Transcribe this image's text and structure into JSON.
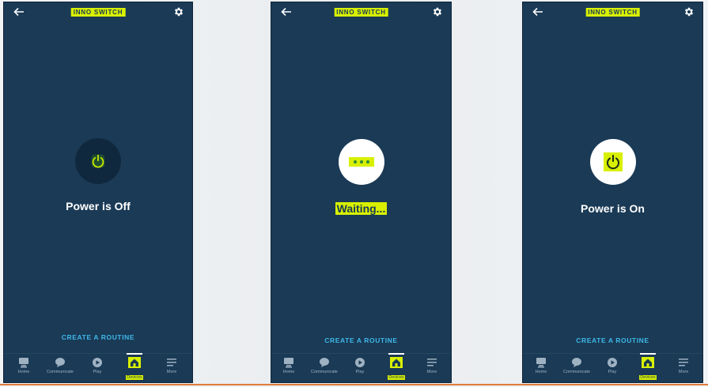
{
  "colors": {
    "accent": "#d8f000",
    "app_background": "#1a3a56",
    "link": "#3fb8e8",
    "separator_line": "#e07b39"
  },
  "screens": [
    {
      "title": "INNO SWITCH",
      "status": "Power is Off",
      "power_button_icon": "power-icon",
      "routine_link": "CREATE A ROUTINE",
      "nav": [
        "Home",
        "Communicate",
        "Play",
        "Devices",
        "More"
      ],
      "active_nav": "Devices"
    },
    {
      "title": "INNO SWITCH",
      "status": "Waiting...",
      "power_button_icon": "ellipsis-icon",
      "routine_link": "CREATE A ROUTINE",
      "nav": [
        "Home",
        "Communicate",
        "Play",
        "Devices",
        "More"
      ],
      "active_nav": "Devices"
    },
    {
      "title": "INNO SWITCH",
      "status": "Power is On",
      "power_button_icon": "power-icon",
      "routine_link": "CREATE A ROUTINE",
      "nav": [
        "Home",
        "Communicate",
        "Play",
        "Devices",
        "More"
      ],
      "active_nav": "Devices"
    }
  ]
}
